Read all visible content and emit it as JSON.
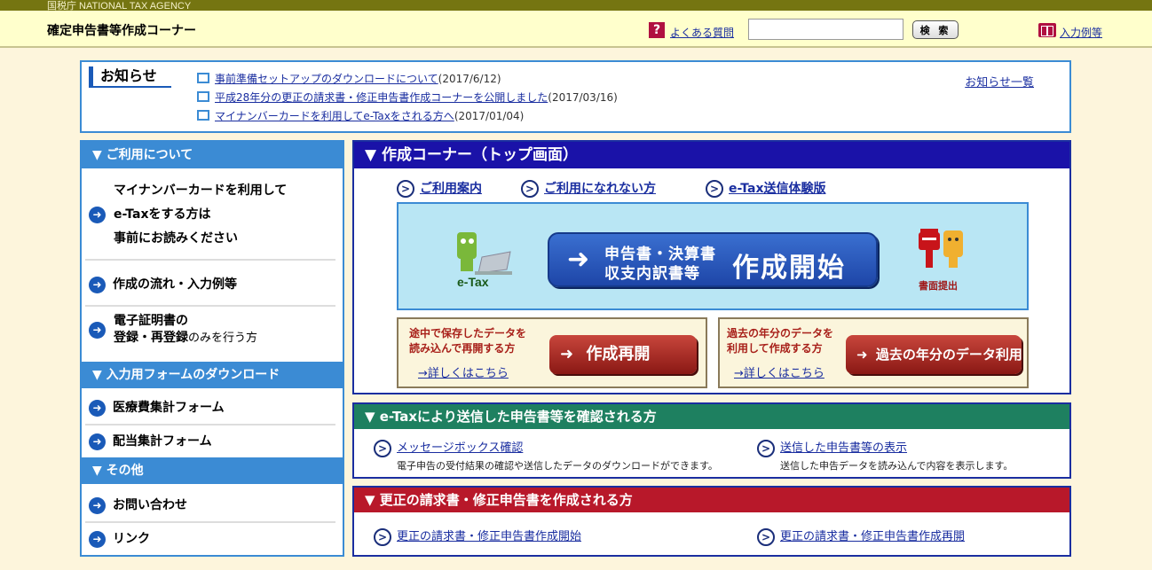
{
  "header": {
    "agency": "国税庁 NATIONAL TAX AGENCY",
    "title": "確定申告書等作成コーナー",
    "faq_label": "よくある質問",
    "search_placeholder": "",
    "search_button": "検 索",
    "example_label": "入力例等"
  },
  "notice": {
    "title": "お知らせ",
    "all_link": "お知らせ一覧",
    "items": [
      {
        "text": "事前準備セットアップのダウンロードについて",
        "date": "(2017/6/12)"
      },
      {
        "text": "平成28年分の更正の請求書・修正申告書作成コーナーを公開しました",
        "date": "(2017/03/16)"
      },
      {
        "text": "マイナンバーカードを利用してe-Taxをされる方へ",
        "date": "(2017/01/04)"
      }
    ]
  },
  "sidebar": {
    "sections": [
      {
        "title": "▼ ご利用について"
      },
      {
        "title": "▼ 入力用フォームのダウンロード"
      },
      {
        "title": "▼ その他"
      }
    ],
    "mynumber": {
      "line1": "マイナンバーカードを利用して",
      "line2": "e-Taxをする方は",
      "line3": "事前にお読みください"
    },
    "flow": "作成の流れ・入力例等",
    "cert": {
      "line1": "電子証明書の",
      "line2a": "登録・再登録",
      "line2b": "のみを行う方"
    },
    "medical": "医療費集計フォーム",
    "dividend": "配当集計フォーム",
    "contact": "お問い合わせ",
    "link": "リンク"
  },
  "main": {
    "title": "▼ 作成コーナー（トップ画面）",
    "guide_links": [
      "ご利用案内",
      "ご利用になれない方",
      "e-Tax送信体験版"
    ],
    "etax_label": "e-Tax",
    "start_sub1": "申告書・決算書",
    "start_sub2": "収支内訳書等",
    "start_main": "作成開始",
    "paper_label": "書面提出",
    "resume": {
      "text1": "途中で保存したデータを",
      "text2": "読み込んで再開する方",
      "more": "→詳しくはこちら",
      "button": "作成再開"
    },
    "past": {
      "text1": "過去の年分のデータを",
      "text2": "利用して作成する方",
      "more": "→詳しくはこちら",
      "button": "過去の年分のデータ利用"
    }
  },
  "etax_section": {
    "title": "▼ e-Taxにより送信した申告書等を確認される方",
    "left_link": "メッセージボックス確認",
    "left_desc": "電子申告の受付結果の確認や送信したデータのダウンロードができます。",
    "right_link": "送信した申告書等の表示",
    "right_desc": "送信した申告データを読み込んで内容を表示します。"
  },
  "amend_section": {
    "title": "▼ 更正の請求書・修正申告書を作成される方",
    "left_link": "更正の請求書・修正申告書作成開始",
    "right_link": "更正の請求書・修正申告書作成再開"
  }
}
